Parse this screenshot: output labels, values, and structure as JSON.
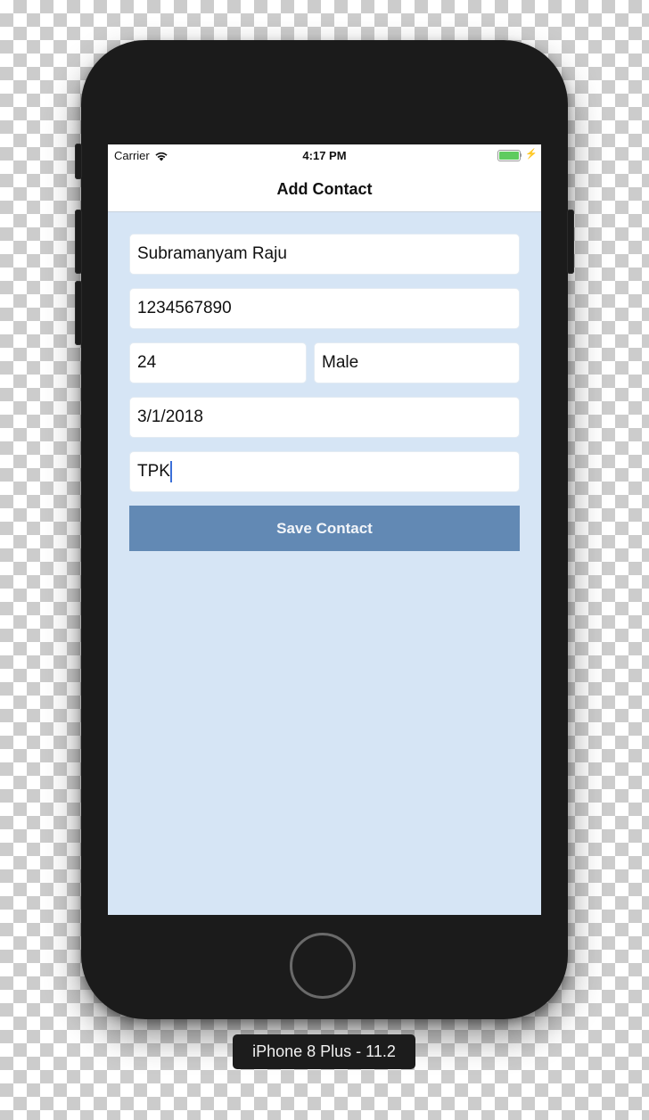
{
  "device": {
    "label": "iPhone 8 Plus - 11.2"
  },
  "status_bar": {
    "carrier": "Carrier",
    "time": "4:17 PM",
    "wifi_icon": "wifi-icon",
    "battery_icon": "battery-icon",
    "charging_icon": "bolt-icon",
    "charging_glyph": "⚡",
    "battery_level": 1.0,
    "battery_color": "#5ecb5e"
  },
  "nav": {
    "title": "Add Contact"
  },
  "form": {
    "name": {
      "value": "Subramanyam Raju"
    },
    "phone": {
      "value": "1234567890"
    },
    "age": {
      "value": "24"
    },
    "gender": {
      "value": "Male"
    },
    "date": {
      "value": "3/1/2018"
    },
    "location": {
      "value": "TPK",
      "focused": true
    },
    "save_label": "Save Contact"
  },
  "colors": {
    "screen_background": "#d6e5f5",
    "button_background": "#6289b4",
    "caret": "#3b6fd8",
    "device_body": "#1b1b1b"
  }
}
